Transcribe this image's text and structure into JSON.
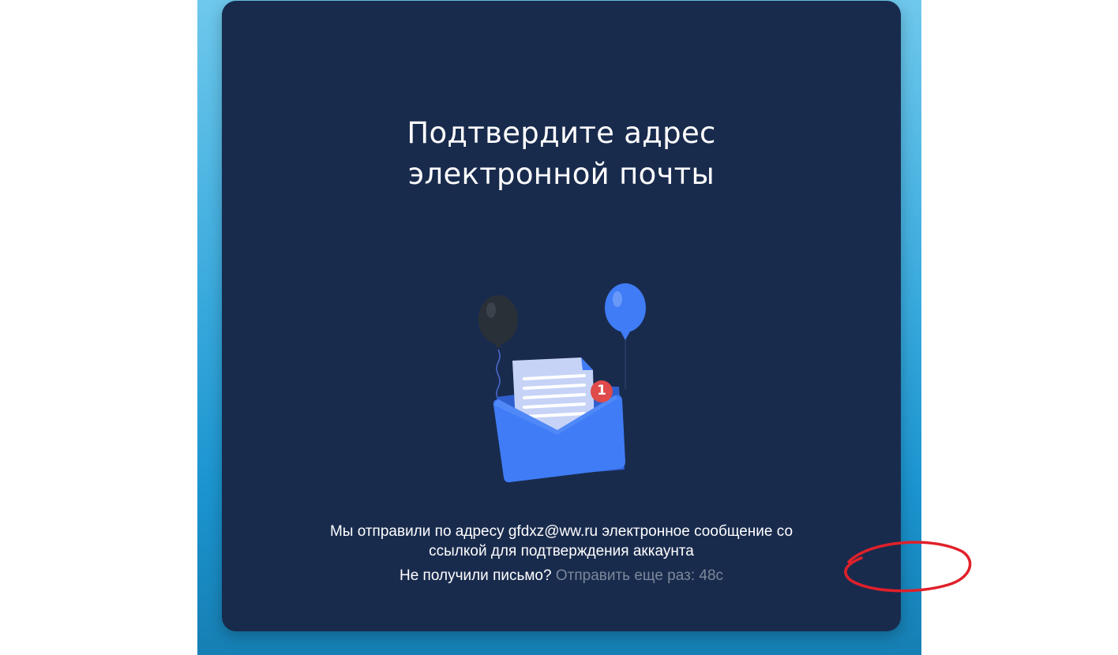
{
  "title": {
    "line1": "Подтвердите адрес",
    "line2": "электронной почты"
  },
  "illustration": {
    "notification_count": "1"
  },
  "message": {
    "line1": "Мы отправили по адресу gfdxz@ww.ru электронное сообщение со",
    "line2": "ссылкой для подтверждения аккаунта"
  },
  "resend": {
    "prompt": "Не получили письмо?",
    "link_text": "Отправить еще раз: 48с"
  },
  "colors": {
    "card_background": "#192b4d",
    "accent_blue": "#3f7cf6",
    "badge_red": "#e04a4a",
    "muted_link": "#7c879a",
    "annotation_red": "#e0202a"
  }
}
